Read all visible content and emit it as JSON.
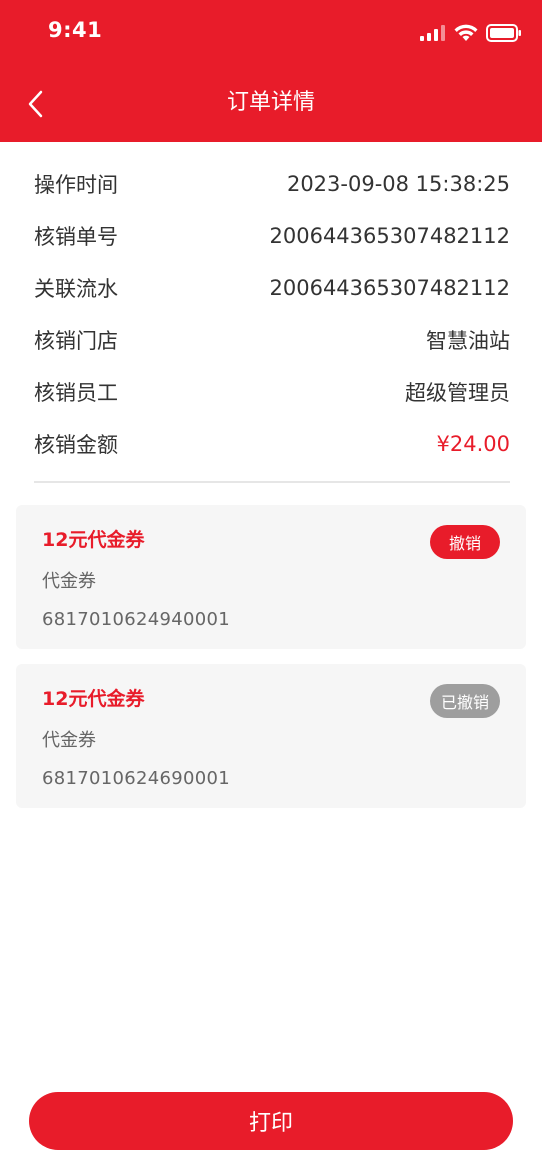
{
  "status_bar": {
    "time": "9:41"
  },
  "header": {
    "title": "订单详情"
  },
  "details": [
    {
      "label": "操作时间",
      "value": "2023-09-08 15:38:25"
    },
    {
      "label": "核销单号",
      "value": "200644365307482112"
    },
    {
      "label": "关联流水",
      "value": "200644365307482112"
    },
    {
      "label": "核销门店",
      "value": "智慧油站"
    },
    {
      "label": "核销员工",
      "value": "超级管理员"
    },
    {
      "label": "核销金额",
      "value": "¥24.00"
    }
  ],
  "coupons": [
    {
      "name": "12元代金券",
      "type": "代金券",
      "code": "6817010624940001",
      "action": "撤销"
    },
    {
      "name": "12元代金券",
      "type": "代金券",
      "code": "6817010624690001",
      "action": "已撤销"
    }
  ],
  "footer": {
    "print_label": "打印"
  },
  "colors": {
    "accent": "#e81c2a",
    "revoked_badge": "#9e9e9e"
  }
}
